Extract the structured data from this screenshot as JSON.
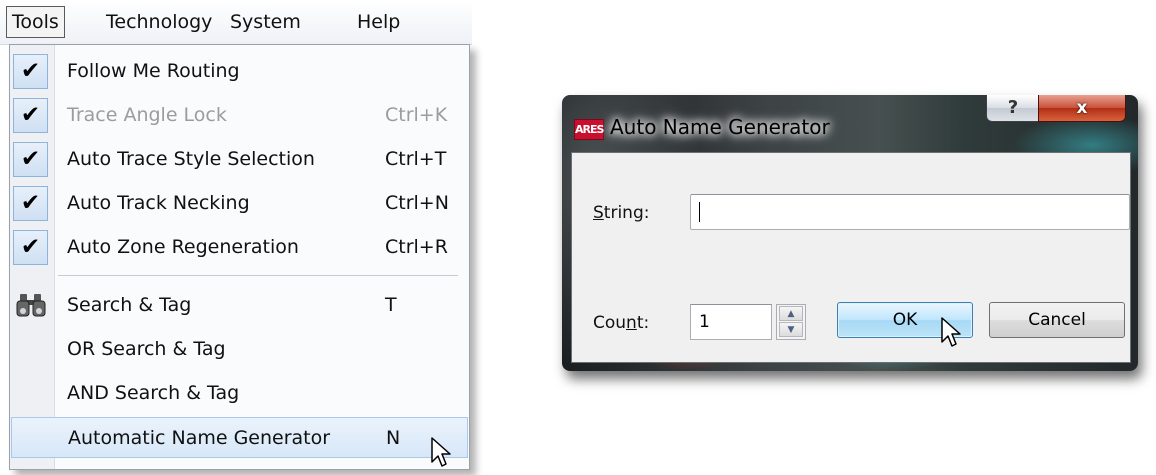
{
  "menubar": {
    "items": [
      {
        "label": "Tools",
        "active": true
      },
      {
        "label": "Technology"
      },
      {
        "label": "System"
      },
      {
        "label": "Help"
      }
    ]
  },
  "tools_menu": {
    "items": [
      {
        "label": "Follow Me Routing",
        "shortcut": "",
        "checked": true,
        "disabled": false
      },
      {
        "label": "Trace Angle Lock",
        "shortcut": "Ctrl+K",
        "checked": true,
        "disabled": true
      },
      {
        "label": "Auto Trace Style Selection",
        "shortcut": "Ctrl+T",
        "checked": true,
        "disabled": false
      },
      {
        "label": "Auto Track Necking",
        "shortcut": "Ctrl+N",
        "checked": true,
        "disabled": false
      },
      {
        "label": "Auto Zone Regeneration",
        "shortcut": "Ctrl+R",
        "checked": true,
        "disabled": false
      },
      {
        "label": "Search & Tag",
        "shortcut": "T",
        "icon": "binoculars-icon"
      },
      {
        "label": "OR Search & Tag",
        "shortcut": ""
      },
      {
        "label": "AND Search & Tag",
        "shortcut": ""
      },
      {
        "label": "Automatic Name Generator",
        "shortcut": "N",
        "highlighted": true
      }
    ],
    "check_glyph": "✔"
  },
  "dialog": {
    "app_icon_text": "ARES",
    "title": "Auto Name Generator",
    "help_button": "?",
    "close_button": "x",
    "string_label_underlined": "S",
    "string_label_rest": "tring:",
    "string_value": "",
    "count_label_pre": "Cou",
    "count_label_underlined": "n",
    "count_label_post": "t:",
    "count_value": "1",
    "ok_label": "OK",
    "cancel_label": "Cancel"
  },
  "colors": {
    "menu_highlight": "#d7e7f8",
    "check_box": "#cfe0f3",
    "close_button": "#c8503a",
    "ok_button": "#bee6fd",
    "app_icon": "#c8102e"
  }
}
